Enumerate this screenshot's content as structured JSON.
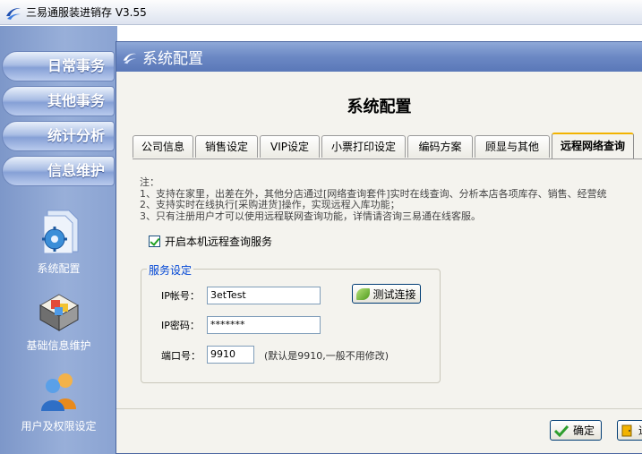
{
  "app": {
    "title": "三易通服装进销存 V3.55",
    "logo_icon": "app-swirl-icon"
  },
  "sidebar": {
    "nav_buttons": [
      {
        "label": "日常事务"
      },
      {
        "label": "其他事务"
      },
      {
        "label": "统计分析"
      },
      {
        "label": "信息维护"
      }
    ],
    "items": [
      {
        "label": "系统配置",
        "icon": "system-config-icon"
      },
      {
        "label": "基础信息维护",
        "icon": "basic-info-icon"
      },
      {
        "label": "用户及权限设定",
        "icon": "users-icon"
      }
    ]
  },
  "collapse_label": "<<",
  "dialog": {
    "header_title": "系统配置",
    "page_title": "系统配置",
    "tabs": [
      {
        "label": "公司信息"
      },
      {
        "label": "销售设定"
      },
      {
        "label": "VIP设定"
      },
      {
        "label": "小票打印设定"
      },
      {
        "label": "编码方案"
      },
      {
        "label": "顾显与其他"
      },
      {
        "label": "远程网络查询",
        "active": true
      }
    ],
    "notes": [
      "注：",
      "1、支持在家里，出差在外，其他分店通过[网络查询套件]实时在线查询、分析本店各项库存、销售、经营统",
      "2、支持实时在线执行[采购进货]操作，实现远程入库功能；",
      "3、只有注册用户才可以使用远程联网查询功能，详情请咨询三易通在线客服。"
    ],
    "enable_remote": {
      "label": "开启本机远程查询服务",
      "checked": true
    },
    "service": {
      "legend": "服务设定",
      "ip_account_label": "IP帐号：",
      "ip_account_value": "3etTest",
      "ip_password_label": "IP密码：",
      "ip_password_value": "*******",
      "port_label": "端口号：",
      "port_value": "9910",
      "port_hint": "(默认是9910,一般不用修改)",
      "test_button": "测试连接"
    },
    "ok_button": "确定",
    "exit_button_partial": "退"
  }
}
